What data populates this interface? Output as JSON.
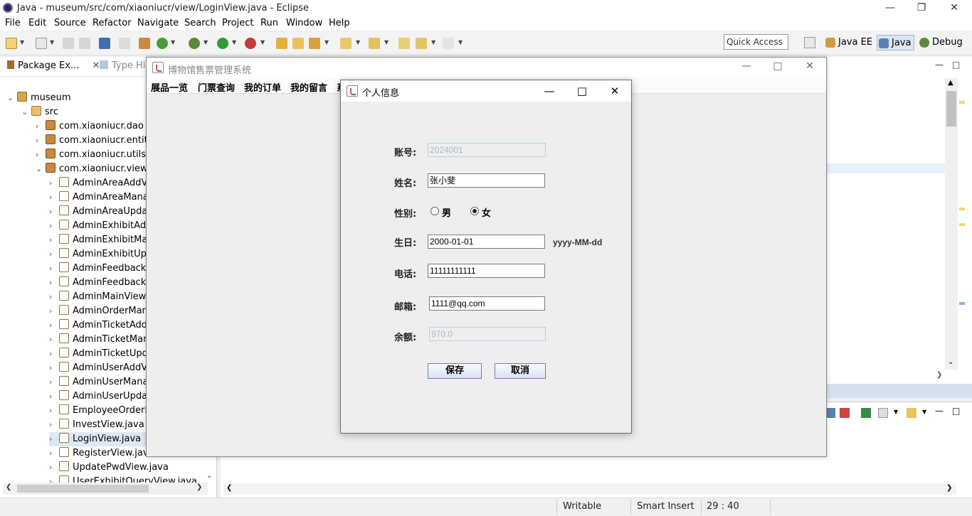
{
  "eclipse": {
    "title": "Java - museum/src/com/xiaoniucr/view/LoginView.java - Eclipse",
    "menu": [
      "File",
      "Edit",
      "Source",
      "Refactor",
      "Navigate",
      "Search",
      "Project",
      "Run",
      "Window",
      "Help"
    ],
    "quick_access": "Quick Access",
    "perspectives": [
      "Java EE",
      "Java",
      "Debug"
    ],
    "tabs": {
      "package_explorer": "Package Ex...",
      "type_hierarchy": "Type Hie"
    },
    "tree": [
      {
        "label": "museum",
        "kind": "proj"
      },
      {
        "label": "src",
        "kind": "src"
      },
      {
        "label": "com.xiaoniucr.dao",
        "kind": "pkg"
      },
      {
        "label": "com.xiaoniucr.entity",
        "kind": "pkg"
      },
      {
        "label": "com.xiaoniucr.utils",
        "kind": "pkg"
      },
      {
        "label": "com.xiaoniucr.view",
        "kind": "pkg"
      },
      {
        "label": "AdminAreaAddVi",
        "kind": "java"
      },
      {
        "label": "AdminAreaManag",
        "kind": "java"
      },
      {
        "label": "AdminAreaUpdat",
        "kind": "java"
      },
      {
        "label": "AdminExhibitAdd",
        "kind": "java"
      },
      {
        "label": "AdminExhibitMan",
        "kind": "java"
      },
      {
        "label": "AdminExhibitUpd",
        "kind": "java"
      },
      {
        "label": "AdminFeedbackM",
        "kind": "java"
      },
      {
        "label": "AdminFeedbackR",
        "kind": "java"
      },
      {
        "label": "AdminMainView.j",
        "kind": "java"
      },
      {
        "label": "AdminOrderMana",
        "kind": "java"
      },
      {
        "label": "AdminTicketAddV",
        "kind": "java"
      },
      {
        "label": "AdminTicketMana",
        "kind": "java"
      },
      {
        "label": "AdminTicketUpda",
        "kind": "java"
      },
      {
        "label": "AdminUserAddVi",
        "kind": "java"
      },
      {
        "label": "AdminUserManag",
        "kind": "java"
      },
      {
        "label": "AdminUserUpdat",
        "kind": "java"
      },
      {
        "label": "EmployeeOrderM",
        "kind": "java"
      },
      {
        "label": "InvestView.java",
        "kind": "java"
      },
      {
        "label": "LoginView.java",
        "kind": "java"
      },
      {
        "label": "RegisterView.java",
        "kind": "java"
      },
      {
        "label": "UpdatePwdView.java",
        "kind": "java"
      },
      {
        "label": "UserExhibitQueryView.java",
        "kind": "java"
      }
    ],
    "status": {
      "writable": "Writable",
      "insert_mode": "Smart Insert",
      "position": "29 : 40"
    }
  },
  "museum": {
    "title": "博物馆售票管理系统",
    "menu": [
      "展品一览",
      "门票查询",
      "我的订单",
      "我的留言",
      "系"
    ]
  },
  "dialog": {
    "title": "个人信息",
    "account_label": "账号:",
    "account_value": "2024001",
    "name_label": "姓名:",
    "name_value": "张小斐",
    "gender_label": "性别:",
    "gender_male": "男",
    "gender_female": "女",
    "gender_selected": "女",
    "birthday_label": "生日:",
    "birthday_value": "2000-01-01",
    "birthday_hint": "yyyy-MM-dd",
    "phone_label": "电话:",
    "phone_value": "11111111111",
    "email_label": "邮箱:",
    "email_value": "1111@qq.com",
    "balance_label": "余额:",
    "balance_value": "970.0",
    "save_label": "保存",
    "cancel_label": "取消"
  }
}
